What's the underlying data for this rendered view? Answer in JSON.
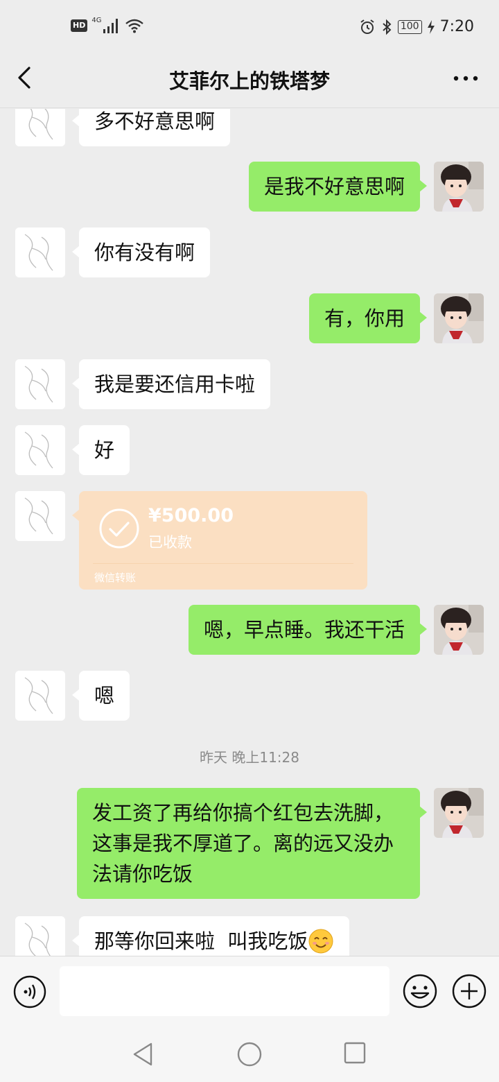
{
  "status_bar": {
    "hd": "HD",
    "network": "4G",
    "battery": "100",
    "time": "7:20"
  },
  "header": {
    "title": "艾菲尔上的铁塔梦"
  },
  "messages": [
    {
      "side": "left",
      "type": "text",
      "text": "多不好意思啊"
    },
    {
      "side": "right",
      "type": "text",
      "text": "是我不好意思啊"
    },
    {
      "side": "left",
      "type": "text",
      "text": "你有没有啊"
    },
    {
      "side": "right",
      "type": "text",
      "text": "有，你用"
    },
    {
      "side": "left",
      "type": "text",
      "text": "我是要还信用卡啦"
    },
    {
      "side": "left",
      "type": "text",
      "text": "好"
    },
    {
      "side": "left",
      "type": "transfer",
      "amount": "¥500.00",
      "status": "已收款",
      "label": "微信转账"
    },
    {
      "side": "right",
      "type": "text",
      "text": "嗯，早点睡。我还干活"
    },
    {
      "side": "left",
      "type": "text",
      "text": "嗯"
    },
    {
      "type": "timestamp",
      "text": "昨天 晚上11:28"
    },
    {
      "side": "right",
      "type": "text",
      "text": "发工资了再给你搞个红包去洗脚，这事是我不厚道了。离的远又没办法请你吃饭"
    },
    {
      "side": "left",
      "type": "text",
      "text": "那等你回来啦  叫我吃饭",
      "emoji": "smiling-face-emoji"
    }
  ],
  "input": {
    "value": "",
    "placeholder": ""
  },
  "icons": {
    "back": "back-arrow-icon",
    "more": "more-dots-icon",
    "voice": "voice-icon",
    "emoji": "emoji-icon",
    "plus": "plus-icon",
    "sys_back": "triangle-back-icon",
    "sys_home": "circle-home-icon",
    "sys_recent": "square-recent-icon"
  },
  "colors": {
    "background": "#ededed",
    "bubble_self": "#95ec69",
    "bubble_other": "#ffffff",
    "transfer_card": "#fbdfc2",
    "timestamp": "#8a8a8a"
  }
}
